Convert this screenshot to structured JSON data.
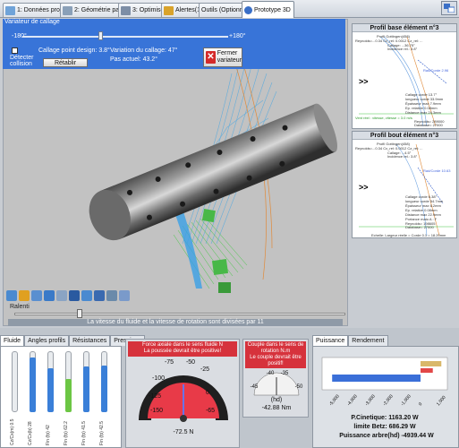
{
  "tabs": [
    {
      "label": "1: Données projet",
      "color": "#6fa3d8"
    },
    {
      "label": "2: Géométrie pale",
      "color": "#8aa0b8"
    },
    {
      "label": "3: Optimiser",
      "color": "#7d8ea6"
    },
    {
      "label": "Alertes(11)",
      "color": "#d9a32b"
    },
    {
      "label": "Outils (Optionnel)",
      "color": "#9aa8b8"
    },
    {
      "label": "Prototype 3D",
      "color": "#3a6fc7"
    }
  ],
  "variateur": {
    "title": "Variateur de callage",
    "min_label": "-180°",
    "max_label": "+180°",
    "detect_label_1": "Détecter",
    "detect_label_2": "collision",
    "callage_design": "Callage point design: 3.8°",
    "variation": "Variation du callage: 47°",
    "pas_actuel": "Pas actuel: 43.2°",
    "retablir": "Rétablir",
    "fermer_1": "Fermer",
    "fermer_2": "variateur"
  },
  "ralenti": {
    "label": "Ralenti",
    "note": "La vitesse du fluide et la vitesse de rotation sont divisées par 11"
  },
  "profile_base": {
    "title": "Profil base élément n°3",
    "top_line": "Profil Gottingen(458)",
    "line2": "Reynolds=...0.34 Cx_rel: 0.0012 Cz_rel: ...",
    "line3": "Callage: ...36.75°",
    "line4": "Incidence rel.: 3.8°",
    "redlabel": "Rad/Corde 2.96",
    "callage_corde": "Callage corde 13.7°",
    "longueur_corde": "longueur corde 33.9mm",
    "epaisseur_max": "Épaisseur max 7.9mm",
    "ep_relative": "Ep. relative 0.08mm",
    "distance_max": "Distance max 24.3mm",
    "portance": "Portance mato A : F",
    "reynolds": "Reynolds= 289000",
    "database": "Database= 27000",
    "bottom": "Echelle: Largeur réelle = Corde 0.1 = 14.34mm",
    "arrow": ">>",
    "green_label": "Vent réel : vitesse, vitesse = 3.0 m/s"
  },
  "profile_tip": {
    "title": "Profil bout élément n°3",
    "top_line": "Profil Gottingen(458)",
    "line2": "Reynolds=...0.34 Cx_rel: 0.0012 Cz_rel: ...",
    "line3": "Callage: ...4.5°",
    "line4": "Incidence rel.: 3.8°",
    "redlabel": "Rad/Corde 10.63",
    "callage_corde": "Callage corde 6.38°",
    "longueur_corde": "longueur corde 54.7mm",
    "epaisseur_max": "Épaisseur max 6.2mm",
    "ep_relative": "Ep. relative 0.08mm",
    "distance_max": "Distance max 22.9mm",
    "portance": "Portance mato A : F",
    "reynolds": "Reynolds= 198605",
    "database": "Database= 27000",
    "bottom": "Echelle: Largeur réelle = Corde 0.1 = 18.20mm",
    "arrow": ">>",
    "green_label": "Vent réel : vitesse, vitesse = 3.0 m/s"
  },
  "bottom_tabs": [
    "Fluide",
    "Angles profils",
    "Résistances",
    "Pressions"
  ],
  "bars": [
    {
      "label": "Cz/Cx(m) 0.5",
      "fill": 0.0,
      "color": "#3a7fd8"
    },
    {
      "label": "Cz/Cx(b) 28",
      "fill": 0.9,
      "color": "#3a7fd8"
    },
    {
      "label": "Fin (fp) 42",
      "fill": 0.72,
      "color": "#3a7fd8"
    },
    {
      "label": "Fin (fp) 62.2",
      "fill": 0.55,
      "color": "#6cc644"
    },
    {
      "label": "Fin (fp) 41.5",
      "fill": 0.75,
      "color": "#3a7fd8"
    },
    {
      "label": "Fin (fp) 42.5",
      "fill": 0.76,
      "color": "#3a7fd8"
    }
  ],
  "gauge_force": {
    "title_1": "Force axiale dans le sens fluide N",
    "title_2": "La poussée devrait être positive!",
    "value": "-72.5 N",
    "ticks": [
      "-100",
      "-75",
      "-50",
      "-25",
      "0",
      "-125",
      "-150",
      "-65"
    ]
  },
  "gauge_couple": {
    "title_1": "Couple dans le sens de",
    "title_2": "rotation N.m",
    "title_3": "Le couple devrait être",
    "title_4": "positif!",
    "unit": "(hd)",
    "value": "-42.88 Nm",
    "ticks": [
      "-40",
      "-35",
      "-45",
      "-50"
    ]
  },
  "puissance": {
    "tabs": [
      "Puissance",
      "Rendement"
    ],
    "p_cinetique": "P.Cinetique: 1163.20 W",
    "limite_betz": "limite Betz: 686.29 W",
    "puissance_arbre": "Puissance arbre(hd) -4939.44 W",
    "ticks": [
      "-5,000",
      "-4,000",
      "-3,000",
      "-2,000",
      "-1,000",
      "0",
      "1,000"
    ],
    "arbre_value": -4939.44,
    "betz_value": 686.29,
    "cinetique_value": 1163.2
  }
}
